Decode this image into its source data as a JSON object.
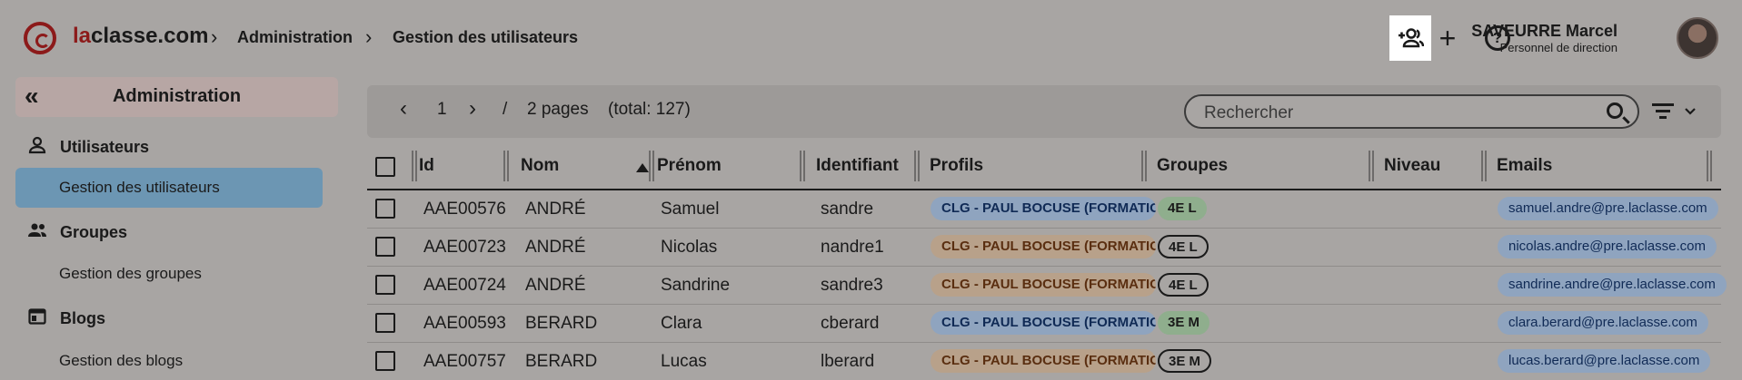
{
  "header": {
    "logo_prefix": "la",
    "logo_suffix": "classe.com",
    "breadcrumb": [
      "Administration",
      "Gestion des utilisateurs"
    ],
    "user_name": "SAVEURRE Marcel",
    "user_role": "Personnel de direction"
  },
  "sidebar": {
    "title": "Administration",
    "sections": [
      {
        "label": "Utilisateurs",
        "link": "Gestion des utilisateurs"
      },
      {
        "label": "Groupes",
        "link": "Gestion des groupes"
      },
      {
        "label": "Blogs",
        "link": "Gestion des blogs"
      }
    ]
  },
  "pager": {
    "current": "1",
    "separator": "/",
    "pages_label": "2 pages",
    "total_label": "(total: 127)"
  },
  "search": {
    "placeholder": "Rechercher"
  },
  "table": {
    "columns": [
      "Id",
      "Nom",
      "Prénom",
      "Identifiant",
      "Profils",
      "Groupes",
      "Niveau",
      "Emails"
    ],
    "rows": [
      {
        "id": "AAE00576",
        "nom": "ANDRÉ",
        "prenom": "Samuel",
        "identifiant": "sandre",
        "profil": "CLG - PAUL BOCUSE (FORMATIO",
        "profil_color": "#8fa4bf",
        "groupe": "4E L",
        "groupe_style": "filled",
        "email": "samuel.andre@pre.laclasse.com"
      },
      {
        "id": "AAE00723",
        "nom": "ANDRÉ",
        "prenom": "Nicolas",
        "identifiant": "nandre1",
        "profil": "CLG - PAUL BOCUSE (FORMATIO",
        "profil_color": "#b8a18a",
        "groupe": "4E L",
        "groupe_style": "outline",
        "email": "nicolas.andre@pre.laclasse.com"
      },
      {
        "id": "AAE00724",
        "nom": "ANDRÉ",
        "prenom": "Sandrine",
        "identifiant": "sandre3",
        "profil": "CLG - PAUL BOCUSE (FORMATIO",
        "profil_color": "#b8a18a",
        "groupe": "4E L",
        "groupe_style": "outline",
        "email": "sandrine.andre@pre.laclasse.com"
      },
      {
        "id": "AAE00593",
        "nom": "BERARD",
        "prenom": "Clara",
        "identifiant": "cberard",
        "profil": "CLG - PAUL BOCUSE (FORMATIO",
        "profil_color": "#8fa4bf",
        "groupe": "3E M",
        "groupe_style": "filled",
        "email": "clara.berard@pre.laclasse.com"
      },
      {
        "id": "AAE00757",
        "nom": "BERARD",
        "prenom": "Lucas",
        "identifiant": "lberard",
        "profil": "CLG - PAUL BOCUSE (FORMATIO",
        "profil_color": "#b8a18a",
        "groupe": "3E M",
        "groupe_style": "outline",
        "email": "lucas.berard@pre.laclasse.com"
      }
    ]
  },
  "colors": {
    "overlay_bg": "#a8a5a3",
    "active_item": "#6c96b3",
    "brand": "#8c1a1a",
    "group_filled": "#8fae8d"
  }
}
